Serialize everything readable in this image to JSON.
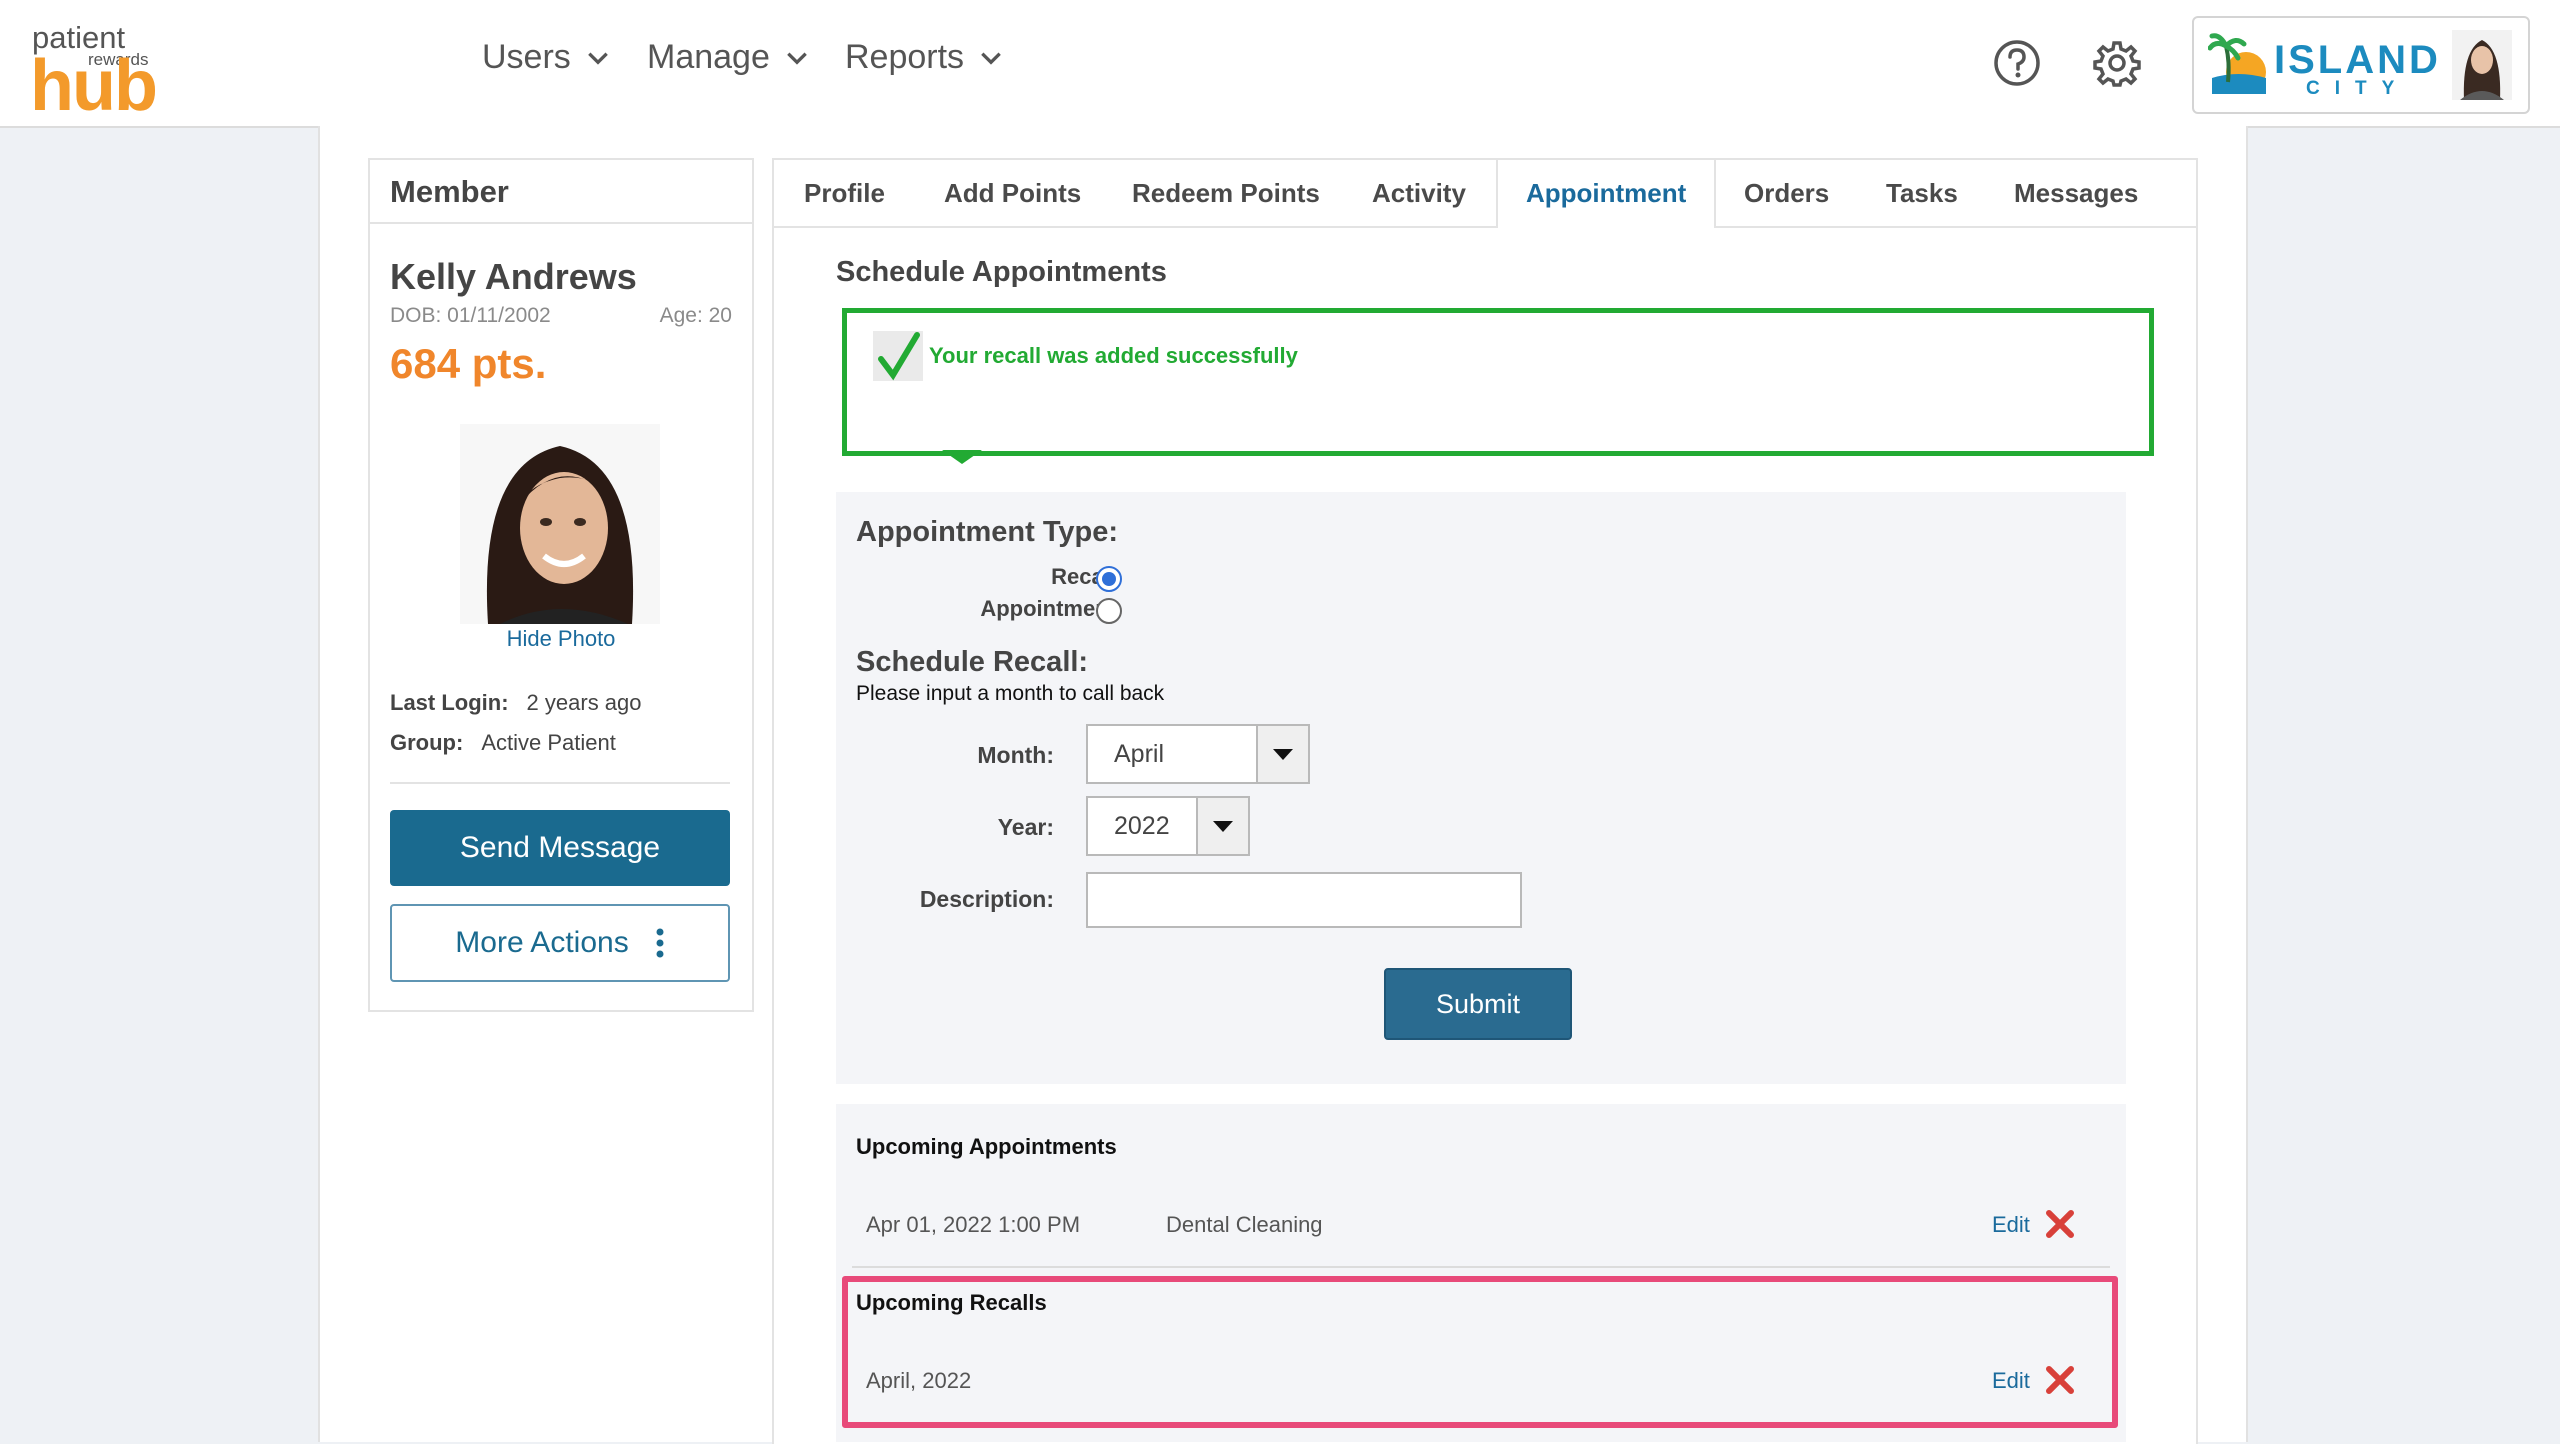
{
  "brand": {
    "logo_top": "patient",
    "logo_small": "rewards",
    "logo_main": "hub",
    "practice_line1": "ISLAND",
    "practice_line2": "CITY"
  },
  "nav": {
    "users": "Users",
    "manage": "Manage",
    "reports": "Reports"
  },
  "member": {
    "heading": "Member",
    "name": "Kelly Andrews",
    "dob": "DOB: 01/11/2002",
    "age": "Age:  20",
    "points": "684 pts.",
    "hide_photo": "Hide Photo",
    "last_login_label": "Last Login:",
    "last_login_value": "2 years ago",
    "group_label": "Group:",
    "group_value": "Active Patient",
    "send_message": "Send Message",
    "more_actions": "More Actions"
  },
  "tabs": [
    "Profile",
    "Add Points",
    "Redeem Points",
    "Activity",
    "Appointment",
    "Orders",
    "Tasks",
    "Messages"
  ],
  "active_tab": "Appointment",
  "schedule": {
    "title": "Schedule Appointments",
    "alert": "Your recall was added successfully",
    "appointment_type_heading": "Appointment Type:",
    "radio_recall": "Recall",
    "radio_appointment": "Appointment",
    "selected_type": "Recall",
    "schedule_recall_heading": "Schedule Recall:",
    "instruction": "Please input a month to call back",
    "month_label": "Month:",
    "month_value": "April",
    "year_label": "Year:",
    "year_value": "2022",
    "description_label": "Description:",
    "description_value": "",
    "submit": "Submit"
  },
  "upcoming": {
    "appointments_title": "Upcoming Appointments",
    "appointments": [
      {
        "datetime": "Apr 01, 2022 1:00 PM",
        "type": "Dental Cleaning",
        "edit": "Edit"
      }
    ],
    "recalls_title": "Upcoming Recalls",
    "recalls": [
      {
        "date": "April, 2022",
        "edit": "Edit"
      }
    ]
  },
  "colors": {
    "accent": "#1a6a9c",
    "points": "#f0862b",
    "success": "#22aa33",
    "highlight": "#e84a7a",
    "logo": "#f39a2b"
  }
}
